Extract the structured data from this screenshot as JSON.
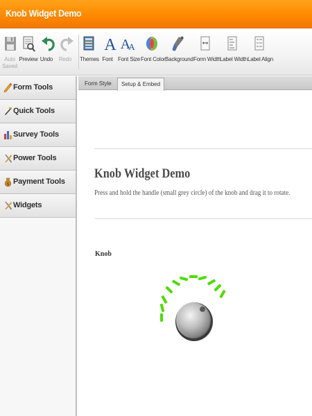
{
  "app": {
    "title": "Knob Widget Demo"
  },
  "toolbar": {
    "items": [
      {
        "label": "Auto",
        "label2": "Saved",
        "icon": "floppy-disk-icon",
        "enabled": false
      },
      {
        "label": "Preview",
        "icon": "preview-icon",
        "enabled": true
      },
      {
        "label": "Undo",
        "icon": "undo-icon",
        "enabled": true
      },
      {
        "label": "Redo",
        "icon": "redo-icon",
        "enabled": false
      },
      {
        "label": "Themes",
        "icon": "themes-icon",
        "enabled": true
      },
      {
        "label": "Font",
        "icon": "font-icon",
        "enabled": true
      },
      {
        "label": "Font Size",
        "icon": "font-size-icon",
        "enabled": true
      },
      {
        "label": "Font Color",
        "icon": "font-color-icon",
        "enabled": true
      },
      {
        "label": "Background",
        "icon": "background-icon",
        "enabled": true
      },
      {
        "label": "Form Width",
        "icon": "form-width-icon",
        "enabled": true
      },
      {
        "label": "Label Width",
        "icon": "label-width-icon",
        "enabled": true
      },
      {
        "label": "Label Align",
        "icon": "label-align-icon",
        "enabled": true
      }
    ]
  },
  "sidebar": {
    "items": [
      {
        "label": "Form Tools",
        "icon": "pencil-icon"
      },
      {
        "label": "Quick Tools",
        "icon": "wand-icon"
      },
      {
        "label": "Survey Tools",
        "icon": "bar-chart-icon"
      },
      {
        "label": "Power Tools",
        "icon": "tools-icon"
      },
      {
        "label": "Payment Tools",
        "icon": "money-bag-icon"
      },
      {
        "label": "Widgets",
        "icon": "widgets-icon"
      }
    ]
  },
  "tabs": [
    {
      "label": "Form Style",
      "active": false
    },
    {
      "label": "Setup & Embed",
      "active": true
    }
  ],
  "form": {
    "title": "Knob Widget Demo",
    "description": "Press and hold the handle (small grey circle) of the knob and drag it to rotate.",
    "field_label": "Knob"
  },
  "colors": {
    "accent": "#ff8c00",
    "knob_lit": "#4cdd00",
    "knob_unlit": "#e6e6e6"
  }
}
